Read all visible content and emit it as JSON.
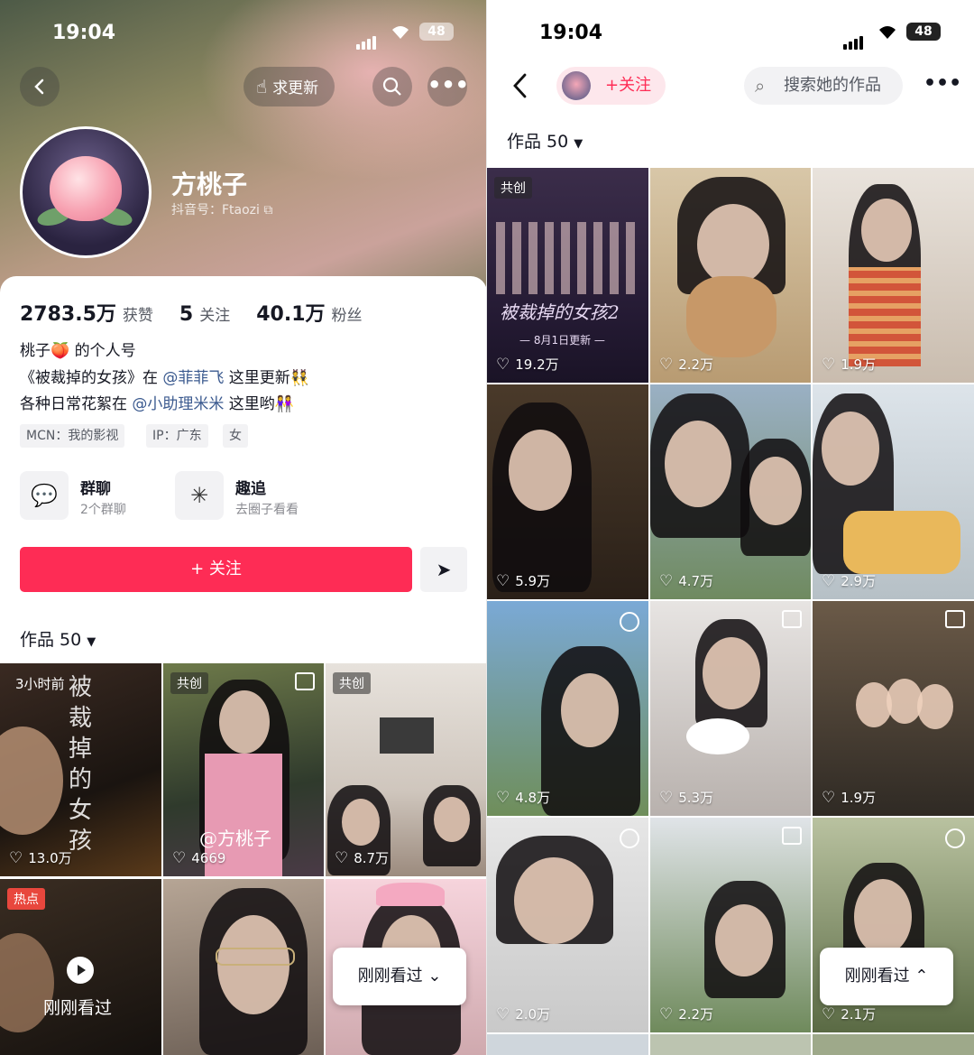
{
  "left": {
    "status": {
      "time": "19:04",
      "battery": "48"
    },
    "header": {
      "request_update_label": "求更新"
    },
    "profile": {
      "nickname": "方桃子",
      "douyin_id": "抖音号：Ftaozi",
      "stats": [
        {
          "value": "2783.5万",
          "label": "获赞"
        },
        {
          "value": "5",
          "label": "关注"
        },
        {
          "value": "40.1万",
          "label": "粉丝"
        }
      ],
      "bio": {
        "line1": "桃子🍑 的个人号",
        "line2_pre": "《被裁掉的女孩》在 ",
        "line2_link": "@菲菲飞",
        "line2_post": " 这里更新👯",
        "line3_pre": "各种日常花絮在 ",
        "line3_link": "@小助理米米",
        "line3_post": " 这里哟👭"
      },
      "tags": [
        "MCN：我的影视",
        "IP：广东",
        "女"
      ],
      "features": [
        {
          "title": "群聊",
          "sub": "2个群聊"
        },
        {
          "title": "趣追",
          "sub": "去圈子看看"
        }
      ],
      "follow_label": "+ 关注"
    },
    "works_tab": "作品 50",
    "grid": [
      {
        "badge": "3小时前",
        "likes": "13.0万",
        "text": "被裁掉的女孩"
      },
      {
        "badge": "共创",
        "likes": "4669",
        "text": "@方桃子"
      },
      {
        "badge": "共创",
        "likes": "8.7万",
        "text": ""
      },
      {
        "badge": "热点",
        "likes": "",
        "text": ""
      },
      {
        "badge": "",
        "likes": "",
        "text": ""
      },
      {
        "badge": "",
        "likes": "",
        "text": ""
      }
    ],
    "just_watched_big": "刚刚看过",
    "just_watched_pill": "刚刚看过 ⌄"
  },
  "right": {
    "status": {
      "time": "19:04",
      "battery": "48"
    },
    "follow_label": "+关注",
    "search_placeholder": "搜索她的作品",
    "works_tab": "作品 50",
    "grid": [
      {
        "badge": "共创",
        "likes": "19.2万",
        "text": "被裁掉的女孩2",
        "text2": "— 8月1日更新 —"
      },
      {
        "badge": "",
        "likes": "2.2万"
      },
      {
        "badge": "",
        "likes": "1.9万"
      },
      {
        "badge": "",
        "likes": "5.9万"
      },
      {
        "badge": "",
        "likes": "4.7万"
      },
      {
        "badge": "",
        "likes": "2.9万"
      },
      {
        "badge": "",
        "likes": "4.8万"
      },
      {
        "badge": "",
        "likes": "5.3万"
      },
      {
        "badge": "",
        "likes": "1.9万"
      },
      {
        "badge": "",
        "likes": "2.0万"
      },
      {
        "badge": "",
        "likes": "2.2万"
      },
      {
        "badge": "",
        "likes": "2.1万"
      }
    ],
    "just_watched_pill": "刚刚看过 ⌃"
  }
}
